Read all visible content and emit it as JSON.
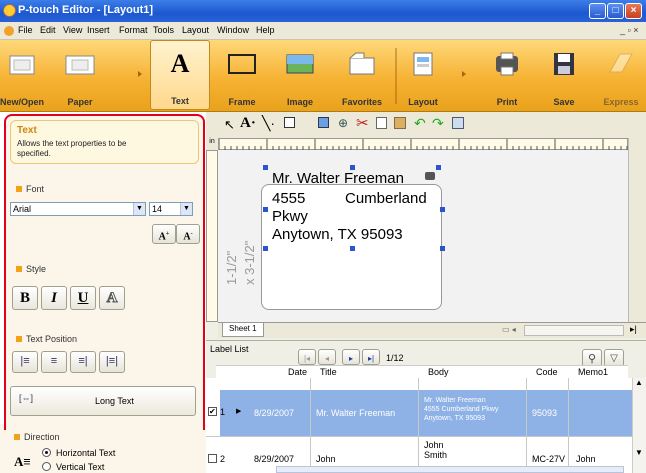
{
  "window": {
    "title": "P-touch Editor - [Layout1]"
  },
  "menu": [
    "File",
    "Edit",
    "View",
    "Insert",
    "Format",
    "Tools",
    "Layout",
    "Window",
    "Help"
  ],
  "toolbar": {
    "new_open": "New/Open",
    "paper": "Paper",
    "text": "Text",
    "frame": "Frame",
    "image": "Image",
    "favorites": "Favorites",
    "layout": "Layout",
    "print": "Print",
    "save": "Save",
    "express": "Express"
  },
  "panel": {
    "title": "Text",
    "desc": "Allows the text properties to be specified.",
    "font_label": "Font",
    "font_value": "Arial",
    "size_value": "14",
    "style_label": "Style",
    "bold": "B",
    "italic": "I",
    "underline": "U",
    "outline": "A",
    "position_label": "Text Position",
    "long_text": "Long Text",
    "direction_label": "Direction",
    "horizontal": "Horizontal Text",
    "vertical": "Vertical Text"
  },
  "canvas": {
    "name": "Mr. Walter Freeman",
    "line1a": "4555",
    "line1b": "Cumberland",
    "line2": "Pkwy",
    "line3": "Anytown, TX 95093",
    "dim1": "1-1/2\"",
    "dim2": "x 3-1/2\"",
    "sheet": "Sheet 1"
  },
  "list": {
    "title": "Label List",
    "page": "1/12",
    "columns": [
      "Date",
      "Title",
      "Body",
      "Code",
      "Memo1"
    ],
    "rows": [
      {
        "n": "1",
        "date": "8/29/2007",
        "title": "Mr. Walter Freeman",
        "body": "Mr. Walter Freeman\n4555 Cumberland Pkwy\nAnytown, TX 95093",
        "code": "95093",
        "memo": ""
      },
      {
        "n": "2",
        "date": "8/29/2007",
        "title": "John",
        "body": "John\nSmith",
        "code": "MC-27V",
        "memo": "John"
      }
    ]
  }
}
